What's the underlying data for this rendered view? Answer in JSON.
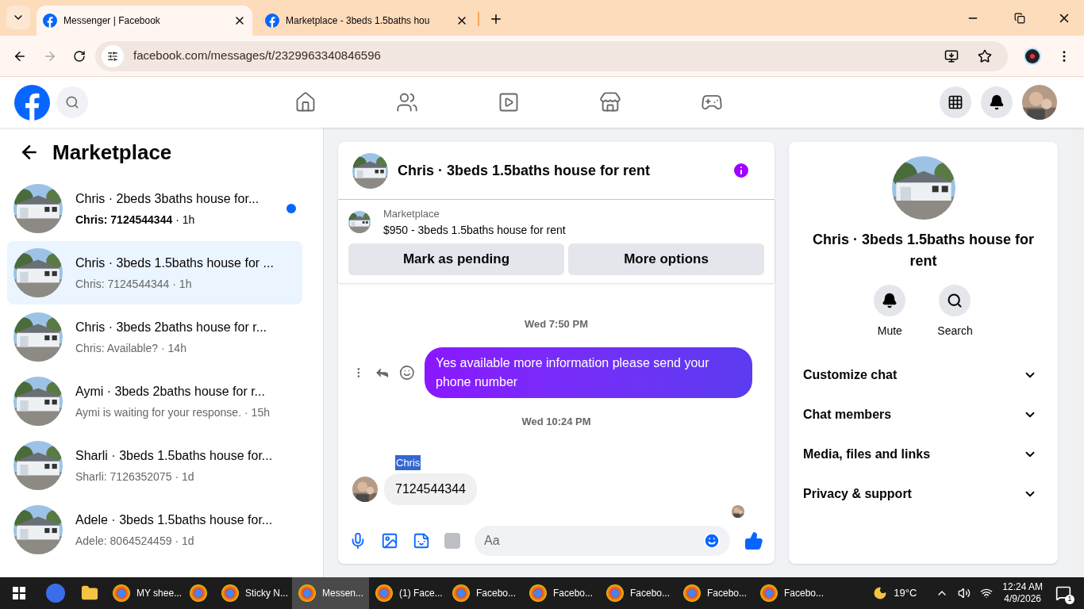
{
  "browser": {
    "tabs": [
      {
        "title": "Messenger | Facebook",
        "selected": true
      },
      {
        "title": "Marketplace - 3beds 1.5baths hou",
        "selected": false
      }
    ],
    "url": "facebook.com/messages/t/2329963340846596"
  },
  "nav": [
    {
      "kind": "home"
    },
    {
      "kind": "friends"
    },
    {
      "kind": "video"
    },
    {
      "kind": "market"
    },
    {
      "kind": "games"
    }
  ],
  "sidebar": {
    "title": "Marketplace",
    "items": [
      {
        "title": "Chris · 2beds 3baths house for...",
        "preview": "Chris: 7124544344",
        "time": "· 1h",
        "unread": true,
        "selected": false
      },
      {
        "title": "Chris · 3beds 1.5baths house for ...",
        "preview": "Chris: 7124544344",
        "time": "· 1h",
        "unread": false,
        "selected": true
      },
      {
        "title": "Chris · 3beds 2baths house for r...",
        "preview": "Chris: Available?",
        "time": "· 14h",
        "unread": false,
        "selected": false
      },
      {
        "title": "Aymi · 3beds 2baths house for r...",
        "preview": "Aymi is waiting for your response.",
        "time": "· 15h",
        "unread": false,
        "selected": false
      },
      {
        "title": "Sharli · 3beds 1.5baths house for...",
        "preview": "Sharli: 7126352075",
        "time": "· 1d",
        "unread": false,
        "selected": false
      },
      {
        "title": "Adele · 3beds 1.5baths house for...",
        "preview": "Adele: 8064524459",
        "time": "· 1d",
        "unread": false,
        "selected": false
      }
    ]
  },
  "chat": {
    "title": "Chris · 3beds 1.5baths house for rent",
    "listing": {
      "label": "Marketplace",
      "text": "$950 - 3beds 1.5baths house for rent"
    },
    "buttons": [
      "Mark as pending",
      "More options"
    ],
    "messages": [
      {
        "kind": "time",
        "text": "Wed 7:50 PM"
      },
      {
        "kind": "sent",
        "text": "Yes available more information please send your phone number"
      },
      {
        "kind": "time",
        "text": "Wed 10:24 PM"
      },
      {
        "kind": "received",
        "sender": "Chris",
        "text": "7124544344"
      }
    ],
    "composer": {
      "placeholder": "Aa"
    }
  },
  "info": {
    "title": "Chris · 3beds 1.5baths house for rent",
    "actions": [
      {
        "kind": "mute",
        "label": "Mute"
      },
      {
        "kind": "search",
        "label": "Search"
      }
    ],
    "sections": [
      "Customize chat",
      "Chat members",
      "Media, files and links",
      "Privacy & support"
    ]
  },
  "taskbar": {
    "apps": [
      {
        "label": "MY shee...",
        "selected": false
      },
      {
        "selected": false
      },
      {
        "label": "Sticky N...",
        "selected": false
      },
      {
        "label": "Messen...",
        "selected": true
      },
      {
        "label": "(1) Face...",
        "selected": false
      },
      {
        "label": "Facebo...",
        "selected": false
      },
      {
        "label": "Facebo...",
        "selected": false
      },
      {
        "label": "Facebo...",
        "selected": false
      },
      {
        "label": "Facebo...",
        "selected": false
      },
      {
        "label": "Facebo...",
        "selected": false
      }
    ],
    "weather": "19°C",
    "time": "12:24 AM",
    "date": "4/9/2026",
    "notifications": "1"
  }
}
